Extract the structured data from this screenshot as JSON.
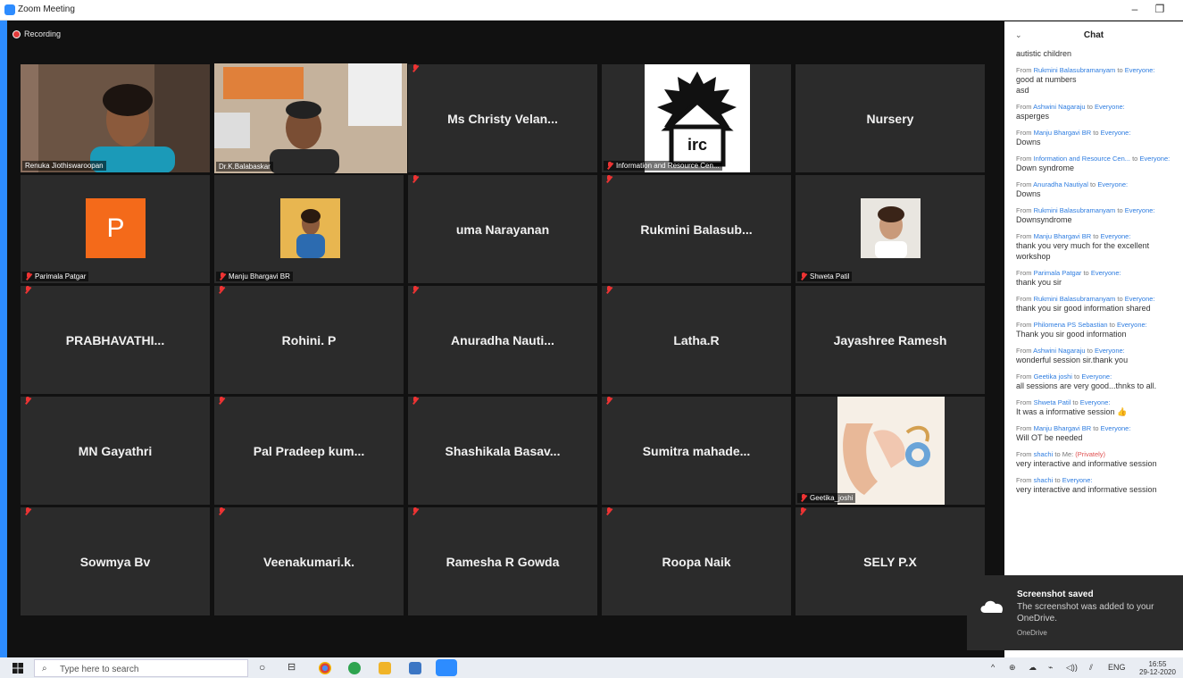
{
  "window": {
    "title": "Zoom Meeting",
    "minimize_glyph": "–",
    "restore_glyph": "❐"
  },
  "recording": {
    "label": "Recording"
  },
  "tiles": {
    "t1": {
      "name": "Renuka Jiothiswaroopan"
    },
    "t2": {
      "name": "Dr.K.Balabaskar"
    },
    "t3": {
      "name": "Ms Christy Velan..."
    },
    "t4": {
      "name": "Information and Resource Cen...",
      "logo_text": "irc"
    },
    "t5": {
      "name": "Nursery"
    },
    "t6": {
      "name": "Parimala Patgar",
      "avatar_letter": "P"
    },
    "t7": {
      "name": "Manju Bhargavi BR"
    },
    "t8": {
      "name": "uma Narayanan"
    },
    "t9": {
      "name": "Rukmini  Balasub..."
    },
    "t10": {
      "name": "Shweta Patil"
    },
    "t11": {
      "name": "PRABHAVATHI..."
    },
    "t12": {
      "name": "Rohini. P"
    },
    "t13": {
      "name": "Anuradha  Nauti..."
    },
    "t14": {
      "name": "Latha.R"
    },
    "t15": {
      "name": "Jayashree Ramesh"
    },
    "t16": {
      "name": "MN Gayathri"
    },
    "t17": {
      "name": "Pal Pradeep kum..."
    },
    "t18": {
      "name": "Shashikala  Basav..."
    },
    "t19": {
      "name": "Sumitra  mahade..."
    },
    "t20": {
      "name": "Geetika_joshi"
    },
    "t21": {
      "name": "Sowmya Bv"
    },
    "t22": {
      "name": "Veenakumari.k."
    },
    "t23": {
      "name": "Ramesha R Gowda"
    },
    "t24": {
      "name": "Roopa Naik"
    },
    "t25": {
      "name": "SELY P.X"
    }
  },
  "chat": {
    "title": "Chat",
    "collapse_glyph": "⌄",
    "first_line": "autistic children",
    "messages": [
      {
        "prefix": "From ",
        "from": "Rukmini Balasubramanyam",
        "mid": " to ",
        "to": "Everyone:",
        "line1": "good at numbers",
        "line2": "asd"
      },
      {
        "prefix": "From ",
        "from": "Ashwini Nagaraju",
        "mid": " to ",
        "to": "Everyone:",
        "line1": "asperges",
        "line2": ""
      },
      {
        "prefix": "From ",
        "from": "Manju Bhargavi BR",
        "mid": " to ",
        "to": "Everyone:",
        "line1": "Downs",
        "line2": ""
      },
      {
        "prefix": "From ",
        "from": "Information and Resource Cen...",
        "mid": "  to ",
        "to": "Everyone:",
        "line1": "Down syndrome",
        "line2": ""
      },
      {
        "prefix": "From ",
        "from": "Anuradha Nautiyal",
        "mid": " to ",
        "to": "Everyone:",
        "line1": "Downs",
        "line2": ""
      },
      {
        "prefix": "From ",
        "from": "Rukmini Balasubramanyam",
        "mid": " to ",
        "to": "Everyone:",
        "line1": "Downsyndrome",
        "line2": ""
      },
      {
        "prefix": "From ",
        "from": "Manju Bhargavi BR",
        "mid": " to ",
        "to": "Everyone:",
        "line1": "thank you very much for the excellent",
        "line2": "workshop"
      },
      {
        "prefix": "From ",
        "from": "Parimala Patgar",
        "mid": " to ",
        "to": "Everyone:",
        "line1": "thank you sir",
        "line2": ""
      },
      {
        "prefix": "From ",
        "from": "Rukmini Balasubramanyam",
        "mid": " to ",
        "to": "Everyone:",
        "line1": "thank you sir good information shared",
        "line2": ""
      },
      {
        "prefix": "From ",
        "from": "Philomena PS Sebastian",
        "mid": " to ",
        "to": "Everyone:",
        "line1": "Thank  you sir good information",
        "line2": ""
      },
      {
        "prefix": "From ",
        "from": "Ashwini Nagaraju",
        "mid": " to ",
        "to": "Everyone:",
        "line1": "wonderful session sir.thank you",
        "line2": ""
      },
      {
        "prefix": "From ",
        "from": "Geetika joshi",
        "mid": " to ",
        "to": "Everyone:",
        "line1": "all sessions are very good...thnks to all.",
        "line2": ""
      },
      {
        "prefix": "From ",
        "from": "Shweta Patil",
        "mid": " to ",
        "to": "Everyone:",
        "line1": "It was a informative session 👍",
        "line2": ""
      },
      {
        "prefix": "From ",
        "from": "Manju Bhargavi BR",
        "mid": " to ",
        "to": "Everyone:",
        "line1": "Will OT be needed",
        "line2": ""
      },
      {
        "prefix": "From ",
        "from": "shachi",
        "mid": " to Me: ",
        "to": "(Privately)",
        "line1": "very interactive and informative session",
        "line2": ""
      },
      {
        "prefix": "From ",
        "from": "shachi",
        "mid": " to ",
        "to": "Everyone:",
        "line1": "very interactive and informative session",
        "line2": ""
      }
    ]
  },
  "toast": {
    "title": "Screenshot saved",
    "body": "The screenshot was added to your OneDrive.",
    "source": "OneDrive"
  },
  "taskbar": {
    "search_placeholder": "Type here to search",
    "search_glyph": "⌕",
    "task_view_glyph": "○",
    "multi_glyph": "⊟",
    "language": "ENG",
    "time": "16:55",
    "date": "29-12-2020",
    "tray_up": "^",
    "tray_icons": [
      "⊕",
      "☁",
      "⌁",
      "◁))",
      "⫽"
    ]
  },
  "colors": {
    "accent": "#2d8cff",
    "mute": "#e33333",
    "active_border": "#c9e04a",
    "tile": "#2b2b2b",
    "avatar": "#f46a1a"
  }
}
